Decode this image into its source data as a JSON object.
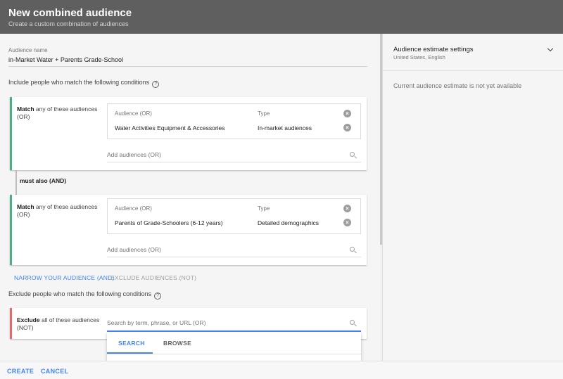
{
  "header": {
    "title": "New combined audience",
    "subtitle": "Create a custom combination of audiences"
  },
  "audience_name": {
    "label": "Audience name",
    "value": "in-Market Water + Parents Grade-School"
  },
  "include_section": {
    "label": "Include people who match the following conditions",
    "help_icon": "?"
  },
  "groups": [
    {
      "match_bold": "Match",
      "match_rest": " any of these audiences (OR)",
      "col_audience": "Audience (OR)",
      "col_type": "Type",
      "audience": "Water Activities Equipment & Accessories",
      "type": "In-market audiences",
      "add_placeholder": "Add audiences (OR)"
    },
    {
      "match_bold": "Match",
      "match_rest": " any of these audiences (OR)",
      "col_audience": "Audience (OR)",
      "col_type": "Type",
      "audience": "Parents of Grade-Schoolers (6-12 years)",
      "type": "Detailed demographics",
      "add_placeholder": "Add audiences (OR)"
    }
  ],
  "and_connector": "must also (AND)",
  "links": {
    "narrow": "NARROW YOUR AUDIENCE (AND)",
    "exclude": "EXCLUDE AUDIENCES (NOT)"
  },
  "exclude_section": {
    "label": "Exclude people who match the following conditions",
    "help_icon": "?",
    "title_bold": "Exclude",
    "title_rest": " all of these audiences (NOT)",
    "search_placeholder": "Search by term, phrase, or URL (OR)"
  },
  "dropdown": {
    "tabs": [
      "SEARCH",
      "BROWSE"
    ],
    "active_tab": "SEARCH"
  },
  "side_panel": {
    "title": "Audience estimate settings",
    "subtitle": "United States, English",
    "estimate_text": "Current audience estimate is not yet available"
  },
  "footer": {
    "create": "CREATE",
    "cancel": "CANCEL"
  },
  "colors": {
    "header_bg": "#5f5f5f",
    "accent": "#4285f4",
    "include_border": "#4caf81",
    "exclude_border": "#e06b6b",
    "link_disabled": "#9e9e9e"
  }
}
